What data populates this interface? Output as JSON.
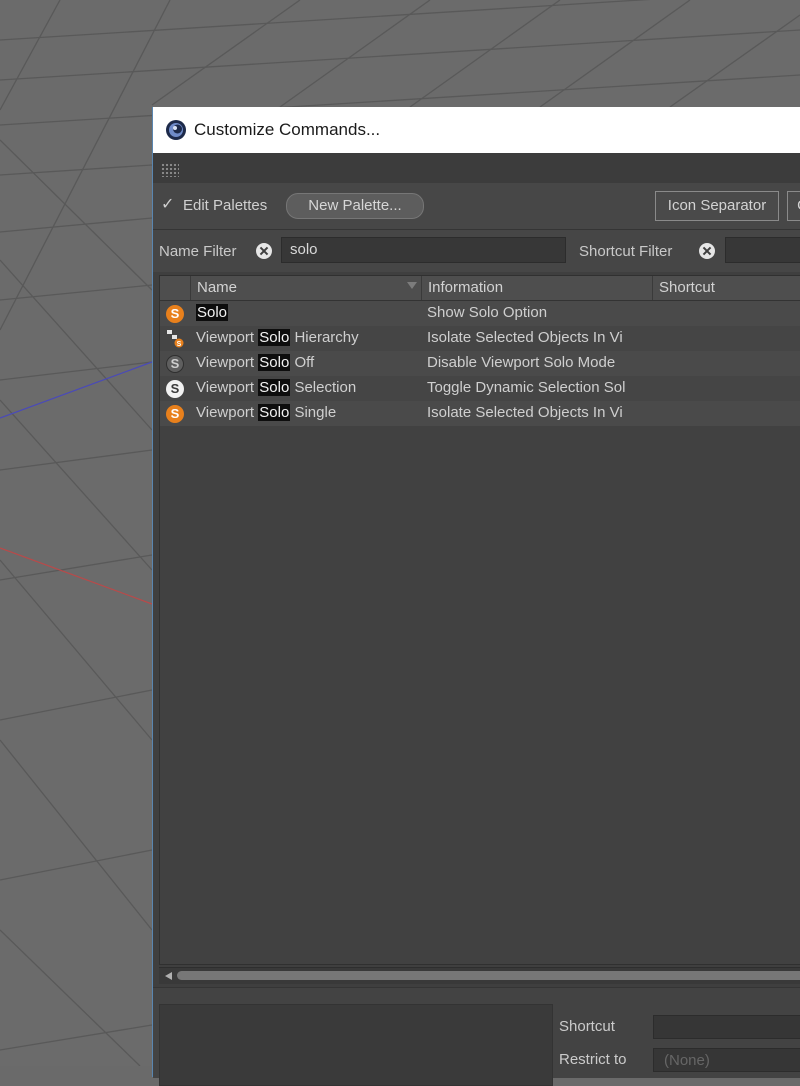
{
  "dialog": {
    "title": "Customize Commands..."
  },
  "toolbar": {
    "edit_palettes_label": "Edit Palettes",
    "new_palette_label": "New Palette...",
    "icon_separator_label": "Icon Separator",
    "next_button_label": "G"
  },
  "filters": {
    "name_filter_label": "Name Filter",
    "name_filter_value": "solo",
    "shortcut_filter_label": "Shortcut Filter",
    "shortcut_filter_value": ""
  },
  "table": {
    "columns": [
      "Name",
      "Information",
      "Shortcut"
    ],
    "rows": [
      {
        "icon": "solo-icon",
        "name_before": "",
        "name_match": "Solo",
        "name_after": "",
        "information": "Show Solo Option",
        "shortcut": ""
      },
      {
        "icon": "hierarchy-icon",
        "name_before": "Viewport ",
        "name_match": "Solo",
        "name_after": " Hierarchy",
        "information": "Isolate Selected Objects In Vi",
        "shortcut": ""
      },
      {
        "icon": "solo-off-icon",
        "name_before": "Viewport ",
        "name_match": "Solo",
        "name_after": " Off",
        "information": "Disable Viewport Solo Mode",
        "shortcut": ""
      },
      {
        "icon": "solo-selection-icon",
        "name_before": "Viewport ",
        "name_match": "Solo",
        "name_after": " Selection",
        "information": "Toggle Dynamic Selection Sol",
        "shortcut": ""
      },
      {
        "icon": "solo-single-icon",
        "name_before": "Viewport ",
        "name_match": "Solo",
        "name_after": " Single",
        "information": "Isolate Selected Objects In Vi",
        "shortcut": ""
      }
    ]
  },
  "bottom": {
    "shortcut_label": "Shortcut",
    "shortcut_value": "",
    "restrict_to_label": "Restrict to",
    "restrict_to_value": "(None)"
  },
  "colors": {
    "orange_icon": "#e8801c",
    "gray_icon": "#5f5f5f",
    "white_icon": "#f2f2f2",
    "dialog_bg": "#3f3f3f"
  }
}
